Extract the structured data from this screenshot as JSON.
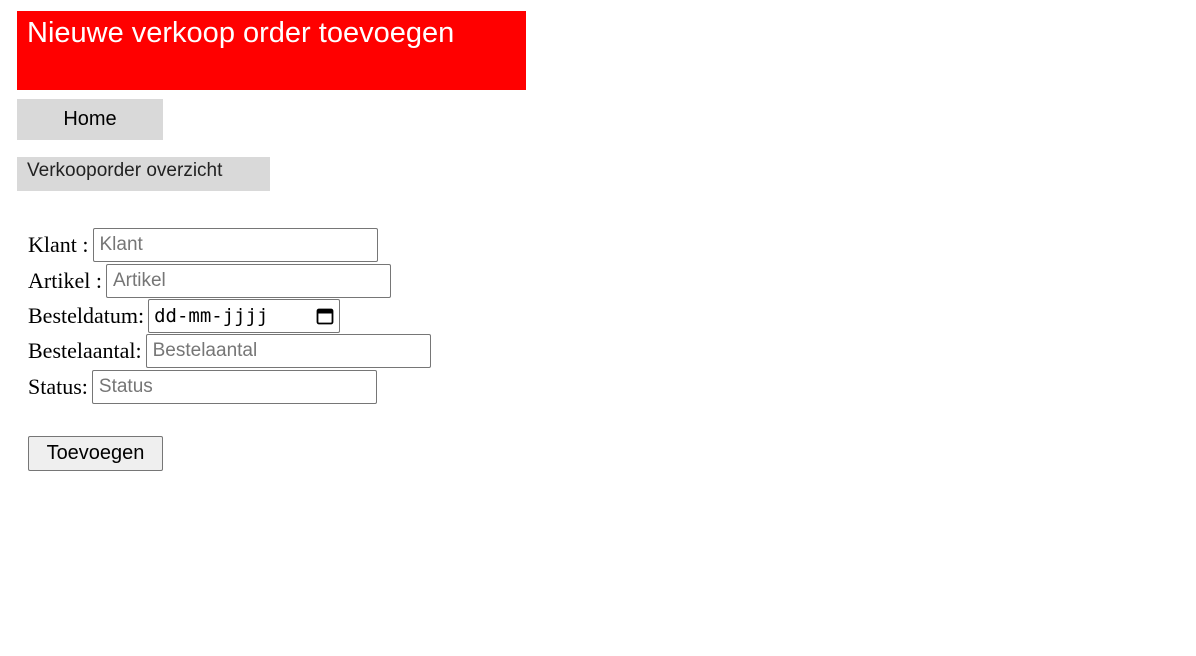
{
  "header": {
    "title": "Nieuwe verkoop order toevoegen",
    "background_color": "#ff0000"
  },
  "nav": {
    "home_label": "Home",
    "overview_label": "Verkooporder overzicht"
  },
  "form": {
    "fields": [
      {
        "label": "Klant :",
        "placeholder": "Klant"
      },
      {
        "label": "Artikel :",
        "placeholder": "Artikel"
      },
      {
        "label": "Besteldatum:",
        "value": "dd-mm-jjjj",
        "icon": "calendar-icon"
      },
      {
        "label": "Bestelaantal:",
        "placeholder": "Bestelaantal"
      },
      {
        "label": "Status:",
        "placeholder": "Status"
      }
    ],
    "submit_label": "Toevoegen"
  }
}
